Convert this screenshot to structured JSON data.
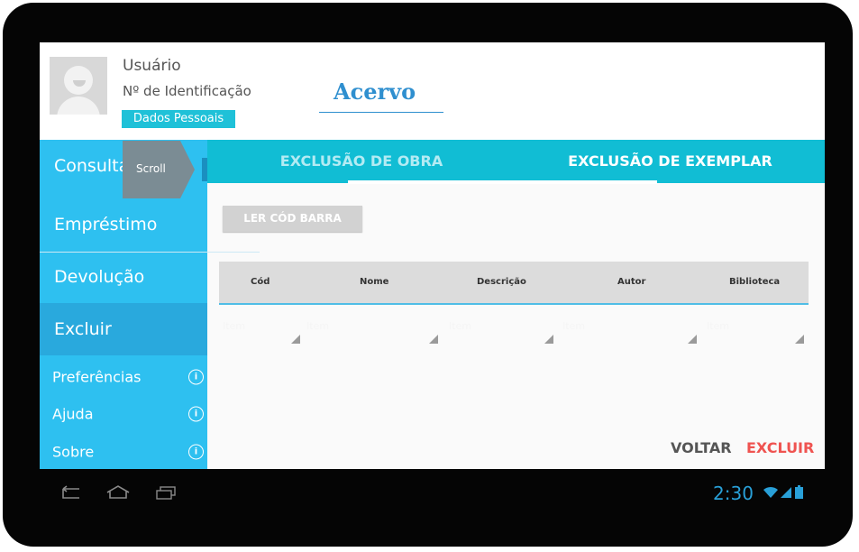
{
  "header": {
    "user_label": "Usuário",
    "id_label": "Nº de Identificação",
    "personal_data_button": "Dados Pessoais",
    "app_title": "Acervo"
  },
  "sidebar": {
    "items": [
      {
        "label": "Consulta"
      },
      {
        "label": "Empréstimo"
      },
      {
        "label": "Devolução"
      },
      {
        "label": "Excluir",
        "active": true
      }
    ],
    "sub_items": [
      {
        "label": "Preferências"
      },
      {
        "label": "Ajuda"
      },
      {
        "label": "Sobre"
      }
    ],
    "scroll_label": "Scroll"
  },
  "tabs": [
    {
      "label": "EXCLUSÃO DE OBRA"
    },
    {
      "label": "EXCLUSÃO DE EXEMPLAR",
      "selected": true
    }
  ],
  "content": {
    "barcode_button": "LER CÓD BARRA",
    "table": {
      "columns": [
        "Cód",
        "Nome",
        "Descrição",
        "Autor",
        "Biblioteca"
      ],
      "placeholders": [
        "Item",
        "Item",
        "Item",
        "Item",
        "Item"
      ]
    },
    "actions": {
      "back": "VOLTAR",
      "delete": "EXCLUIR"
    }
  },
  "status_bar": {
    "time": "2:30"
  },
  "colors": {
    "accent": "#11bdd4",
    "sidebar": "#2ec0f0",
    "delete": "#ef5350"
  }
}
